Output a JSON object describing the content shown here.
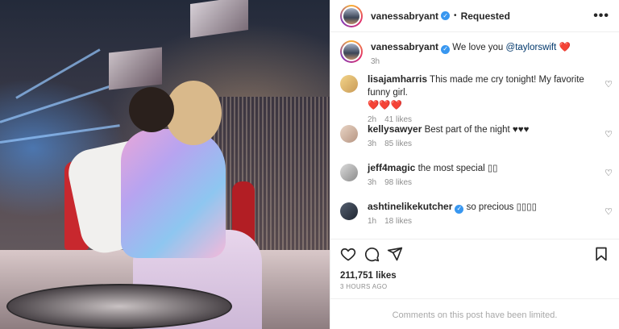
{
  "header": {
    "username": "vanessabryant",
    "status": "Requested",
    "more_icon": "more-horizontal-icon"
  },
  "caption": {
    "username": "vanessabryant",
    "text": "We love you",
    "mention": "@taylorswift",
    "heart": "❤️",
    "time": "3h"
  },
  "comments": [
    {
      "username": "lisajamharris",
      "text": "This made me cry tonight! My favorite funny girl.",
      "extra": "❤️❤️❤️",
      "time": "2h",
      "likes": "41 likes",
      "verified": false
    },
    {
      "username": "kellysawyer",
      "text": "Best part of the night ♥♥♥",
      "time": "3h",
      "likes": "85 likes",
      "verified": false
    },
    {
      "username": "jeff4magic",
      "text": "the most special ▯▯",
      "time": "3h",
      "likes": "98 likes",
      "verified": false
    },
    {
      "username": "ashtinelikekutcher",
      "text": "so precious ▯▯▯▯",
      "time": "1h",
      "likes": "18 likes",
      "verified": true
    }
  ],
  "stats": {
    "likes": "211,751 likes",
    "ago": "3 HOURS AGO"
  },
  "footer": {
    "limited_text": "Comments on this post have been limited."
  },
  "colors": {
    "verified": "#3897f0",
    "heart": "#ed4956",
    "mention": "#00376b"
  }
}
